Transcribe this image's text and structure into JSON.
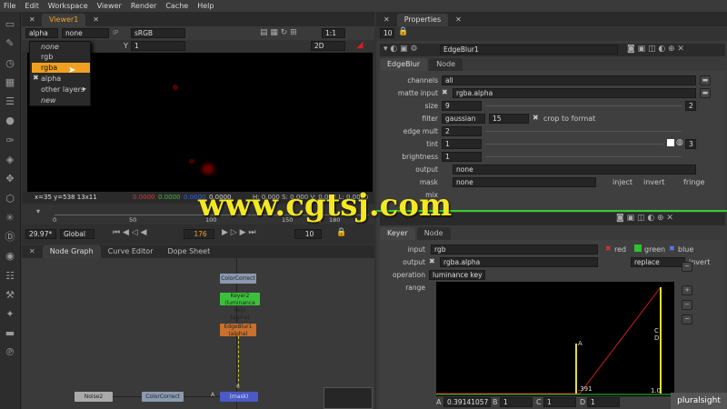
{
  "menu": [
    "File",
    "Edit",
    "Workspace",
    "Viewer",
    "Render",
    "Cache",
    "Help"
  ],
  "viewer": {
    "tab": "Viewer1",
    "channel_value": "alpha",
    "second_value": "none",
    "ip_label": "IP",
    "colorspace": "sRGB",
    "y_label": "Y",
    "y_value": "1",
    "zoom": "1:1",
    "view_mode": "2D",
    "coords": "x=35 y=538 13x11",
    "pixel_values": [
      "0.0000",
      "0.0000",
      "0.0000",
      "0.0000"
    ],
    "pixel_rest": "H: 0.000 S: 0.000 V: 0.000 L: 0.0000",
    "fps": "29.97*",
    "global": "Global",
    "frame": "176",
    "step": "10",
    "timeline_ticks": [
      "0",
      "50",
      "100",
      "150",
      "180"
    ]
  },
  "dropdown": {
    "items": [
      "none",
      "rgb",
      "rgba",
      "alpha",
      "other layers",
      "new"
    ],
    "selected": "rgba",
    "checked": "alpha"
  },
  "bottom_tabs": [
    "Node Graph",
    "Curve Editor",
    "Dope Sheet"
  ],
  "nodes": {
    "colorcorrect_top": "ColorCorrect",
    "keyer": "Keyer2 (luminance key)",
    "keyer_sub": "(alpha)",
    "edgeblur": "EdgeBlur1",
    "edgeblur_sub": "(alpha)",
    "noise": "Noise2",
    "colorcorrect_bottom": "ColorCorrect",
    "merge": "(mask)",
    "merge_num": "6",
    "merge_label": "A"
  },
  "properties": {
    "tab": "Properties",
    "count": "10",
    "node1": {
      "name": "EdgeBlur1",
      "tabs": [
        "EdgeBlur",
        "Node"
      ],
      "channels": "all",
      "matte_input": "rgba.alpha",
      "size": "9",
      "size_right": "2",
      "filter": "gaussian",
      "filter_num": "15",
      "crop": "crop to format",
      "edge_mult": "2",
      "tint": "1",
      "tint_right": "3",
      "brightness": "1",
      "output": "none",
      "mask": "none",
      "inject": "inject",
      "invert": "invert",
      "fringe": "fringe",
      "mix_label": "mix"
    },
    "labels": {
      "channels": "channels",
      "matte_input": "matte input",
      "size": "size",
      "filter": "filter",
      "edge_mult": "edge mult",
      "tint": "tint",
      "brightness": "brightness",
      "output": "output",
      "mask": "mask"
    },
    "node2": {
      "tabs": [
        "Keyer",
        "Node"
      ],
      "input_label": "input",
      "input": "rgb",
      "red": "red",
      "green": "green",
      "blue": "blue",
      "output_label": "output",
      "output": "rgba.alpha",
      "replace": "replace",
      "invert": "invert",
      "operation_label": "operation",
      "operation": "luminance key",
      "range_label": "range",
      "curve_a": "A",
      "curve_c": "C",
      "curve_d": "D",
      "curve_val": ".391",
      "curve_one": "1.0",
      "a_label": "A",
      "a_value": "0.39141057",
      "b_label": "B",
      "b_value": "1",
      "c_label": "C",
      "c_value": "1",
      "d_label": "D",
      "d_value": "1"
    }
  },
  "watermark": "www.cgtsj.com",
  "brand": "pluralsight",
  "colors": {
    "accent": "#f0a020",
    "green": "#40c040",
    "red": "#cc2020"
  }
}
